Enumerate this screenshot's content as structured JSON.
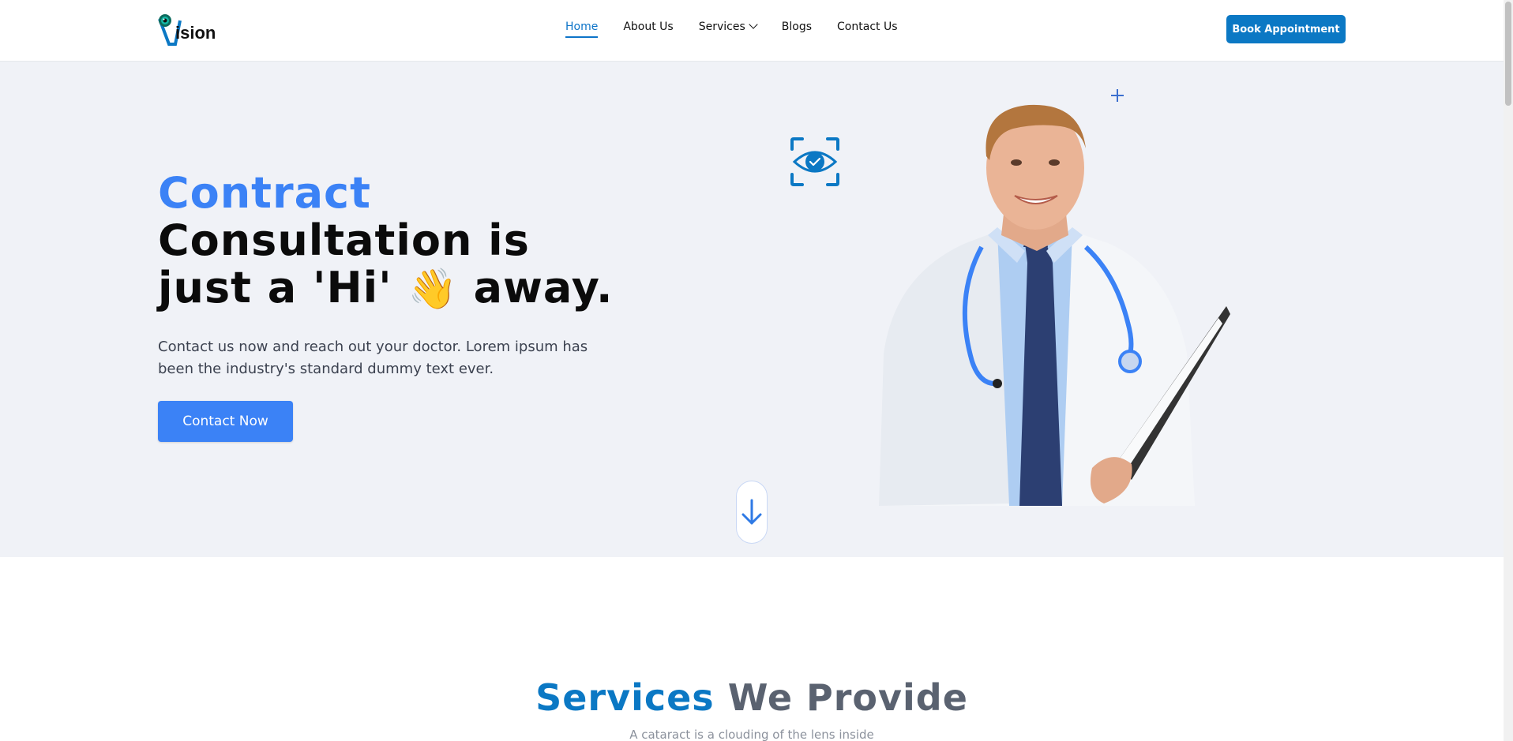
{
  "header": {
    "logo_text": "ision",
    "nav": [
      {
        "label": "Home",
        "active": true
      },
      {
        "label": "About Us",
        "active": false
      },
      {
        "label": "Services",
        "active": false,
        "dropdown": true
      },
      {
        "label": "Blogs",
        "active": false
      },
      {
        "label": "Contact Us",
        "active": false
      }
    ],
    "book_button": "Book Appointment"
  },
  "hero": {
    "title_accent": "Contract",
    "title_line2": "Consultation is",
    "title_line3_pre": "just a 'Hi'",
    "title_emoji": "👋",
    "title_line3_post": "away.",
    "description": "Contact us now and reach out your doctor. Lorem ipsum has been the industry's standard dummy text ever.",
    "cta": "Contact Now",
    "icons": [
      "plus-icon",
      "eye-check-icon",
      "arrow-down-icon"
    ]
  },
  "services": {
    "title_accent": "Services",
    "title_rest": "We Provide",
    "subtitle": "A cataract is a clouding of the lens inside"
  },
  "colors": {
    "brand": "#0b78c4",
    "accent": "#3b82f6",
    "hero_bg": "#f0f2f7"
  }
}
